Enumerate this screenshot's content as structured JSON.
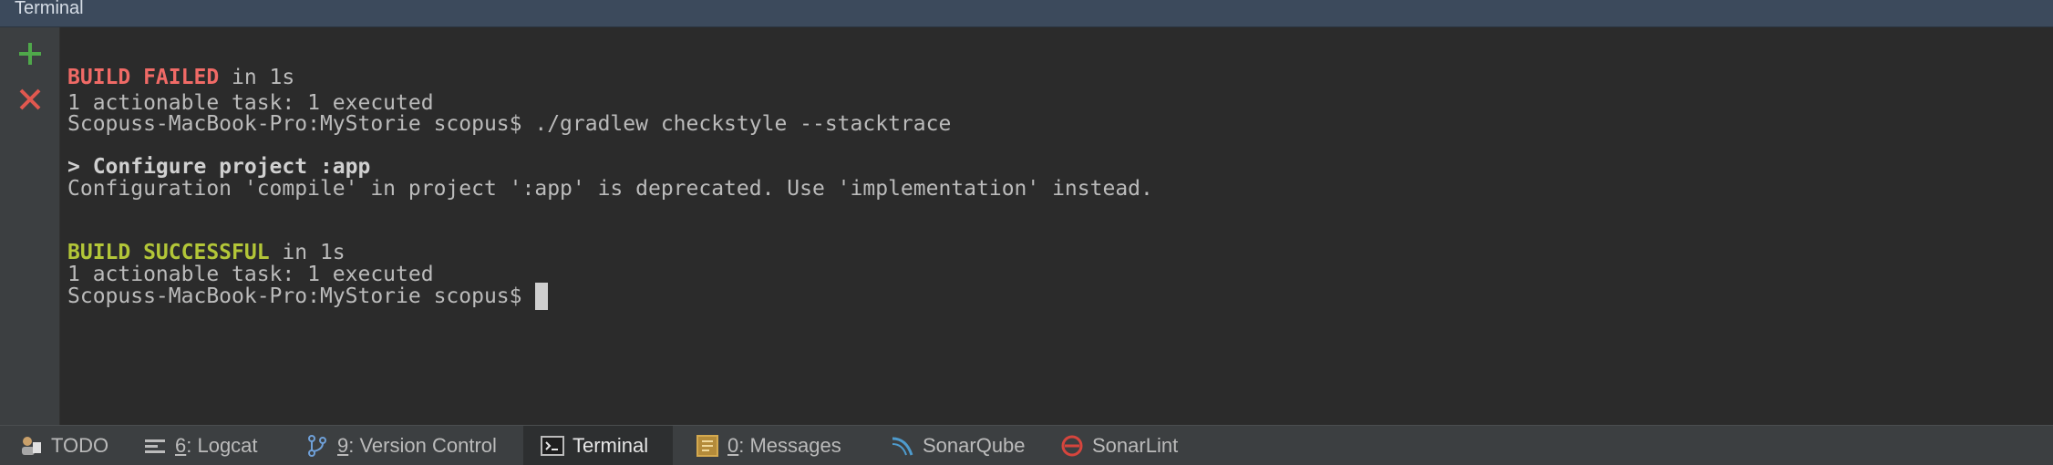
{
  "window": {
    "title": "Terminal"
  },
  "sidebar": {
    "buttons": [
      {
        "icon": "plus-icon",
        "color": "#4fa84a"
      },
      {
        "icon": "close-icon",
        "color": "#e0584f"
      }
    ]
  },
  "terminal": {
    "lines": [
      {
        "highlight": "BUILD FAILED",
        "rest": " in 1s"
      },
      {
        "text": "1 actionable task: 1 executed"
      },
      {
        "text": "Scopuss-MacBook-Pro:MyStorie scopus$ ./gradlew checkstyle --stacktrace"
      },
      {
        "text": ""
      },
      {
        "bold": "> Configure project :app"
      },
      {
        "text": "Configuration 'compile' in project ':app' is deprecated. Use 'implementation' instead."
      },
      {
        "text": ""
      },
      {
        "text": ""
      },
      {
        "highlight": "BUILD SUCCESSFUL",
        "rest": " in 1s"
      },
      {
        "text": "1 actionable task: 1 executed"
      },
      {
        "prompt": "Scopuss-MacBook-Pro:MyStorie scopus$"
      }
    ],
    "colors": {
      "failed": "#f06a66",
      "success": "#b3c638",
      "text": "#bbbbbb"
    }
  },
  "toolbar": {
    "tabs": [
      {
        "icon": "todo-icon",
        "label": "TODO"
      },
      {
        "icon": "logcat-icon",
        "mnemonic": "6",
        "label": ": Logcat"
      },
      {
        "icon": "version-control-icon",
        "mnemonic": "9",
        "label": ": Version Control"
      },
      {
        "icon": "terminal-icon",
        "label": "Terminal",
        "active": true
      },
      {
        "icon": "messages-icon",
        "mnemonic": "0",
        "label": ": Messages"
      },
      {
        "icon": "sonarqube-icon",
        "label": "SonarQube"
      },
      {
        "icon": "sonarlint-icon",
        "label": "SonarLint"
      }
    ]
  }
}
